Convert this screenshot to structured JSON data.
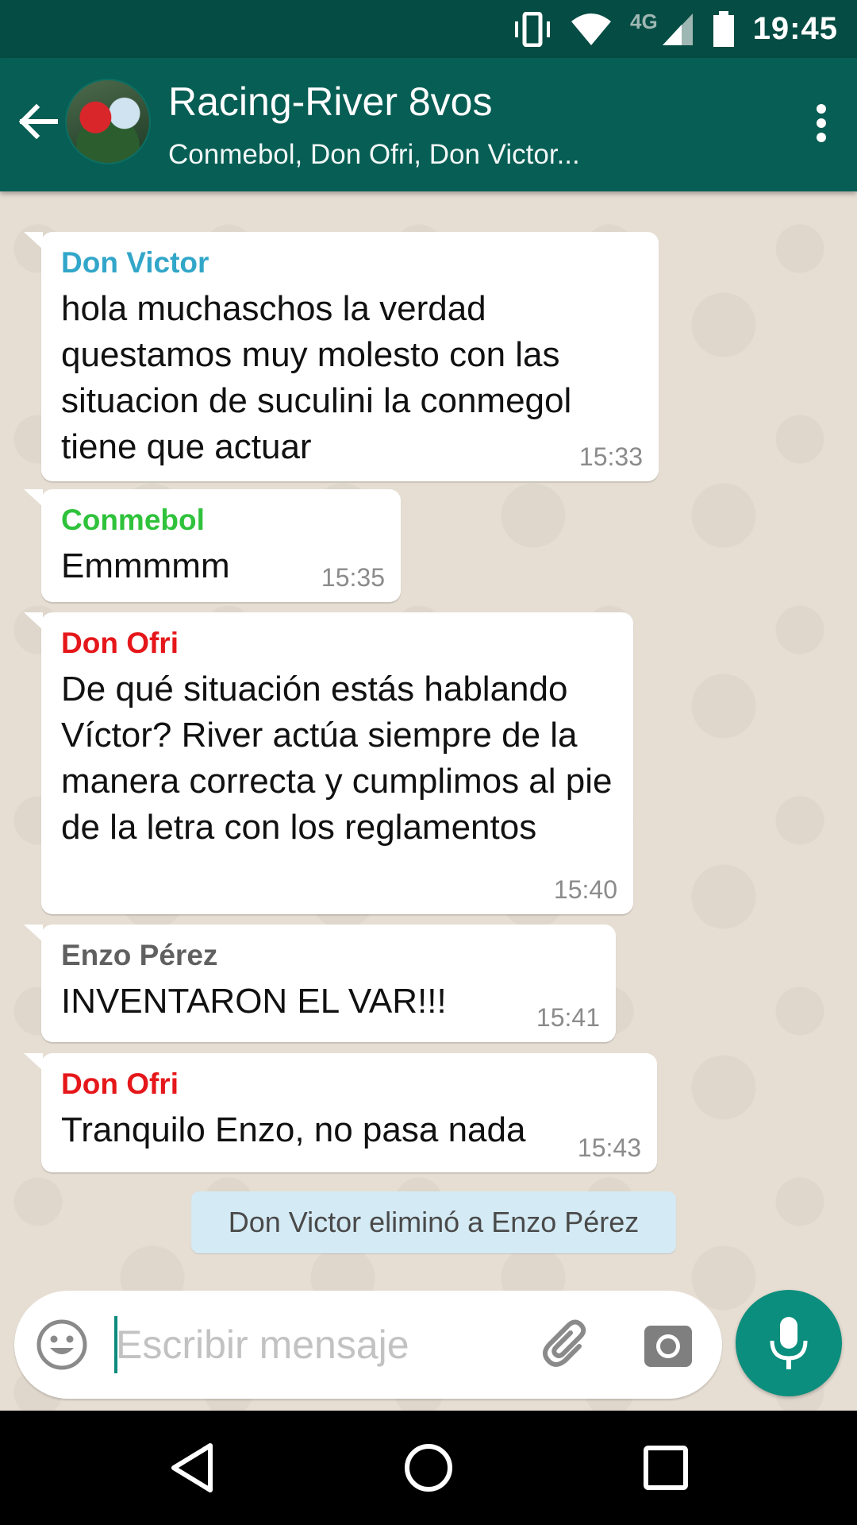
{
  "status_bar": {
    "network": "4G",
    "time": "19:45"
  },
  "header": {
    "title": "Racing-River 8vos",
    "subtitle": "Conmebol, Don Ofri, Don Victor..."
  },
  "messages": [
    {
      "sender": "Don Victor",
      "sender_color": "#32a6c9",
      "text": "hola muchaschos la verdad questamos muy molesto con las situacion de suculini la conmegol tiene que actuar",
      "time": "15:33"
    },
    {
      "sender": "Conmebol",
      "sender_color": "#2fc23b",
      "text": "Emmmmm",
      "time": "15:35"
    },
    {
      "sender": "Don Ofri",
      "sender_color": "#e5171a",
      "text": "De qué situación estás hablando Víctor? River actúa siempre de la manera correcta y cumplimos al pie de la letra con los reglamentos",
      "time": "15:40"
    },
    {
      "sender": "Enzo Pérez",
      "sender_color": "#606060",
      "text": "INVENTARON EL VAR!!!",
      "time": "15:41"
    },
    {
      "sender": "Don Ofri",
      "sender_color": "#e5171a",
      "text": "Tranquilo Enzo, no pasa nada",
      "time": "15:43"
    }
  ],
  "system_note": "Don Victor eliminó a Enzo Pérez",
  "composer": {
    "placeholder": "Escribir mensaje",
    "value": ""
  },
  "icons": {
    "back": "arrow-left",
    "menu": "more-vertical",
    "emoji": "emoji-smile",
    "attach": "paperclip",
    "camera": "camera",
    "mic": "microphone",
    "nav": [
      "back-triangle",
      "home-circle",
      "recents-square"
    ]
  },
  "colors": {
    "status_bar": "#054d44",
    "app_bar": "#075e54",
    "accent": "#0b8e7d",
    "system_note_bg": "#d4eaf4"
  }
}
